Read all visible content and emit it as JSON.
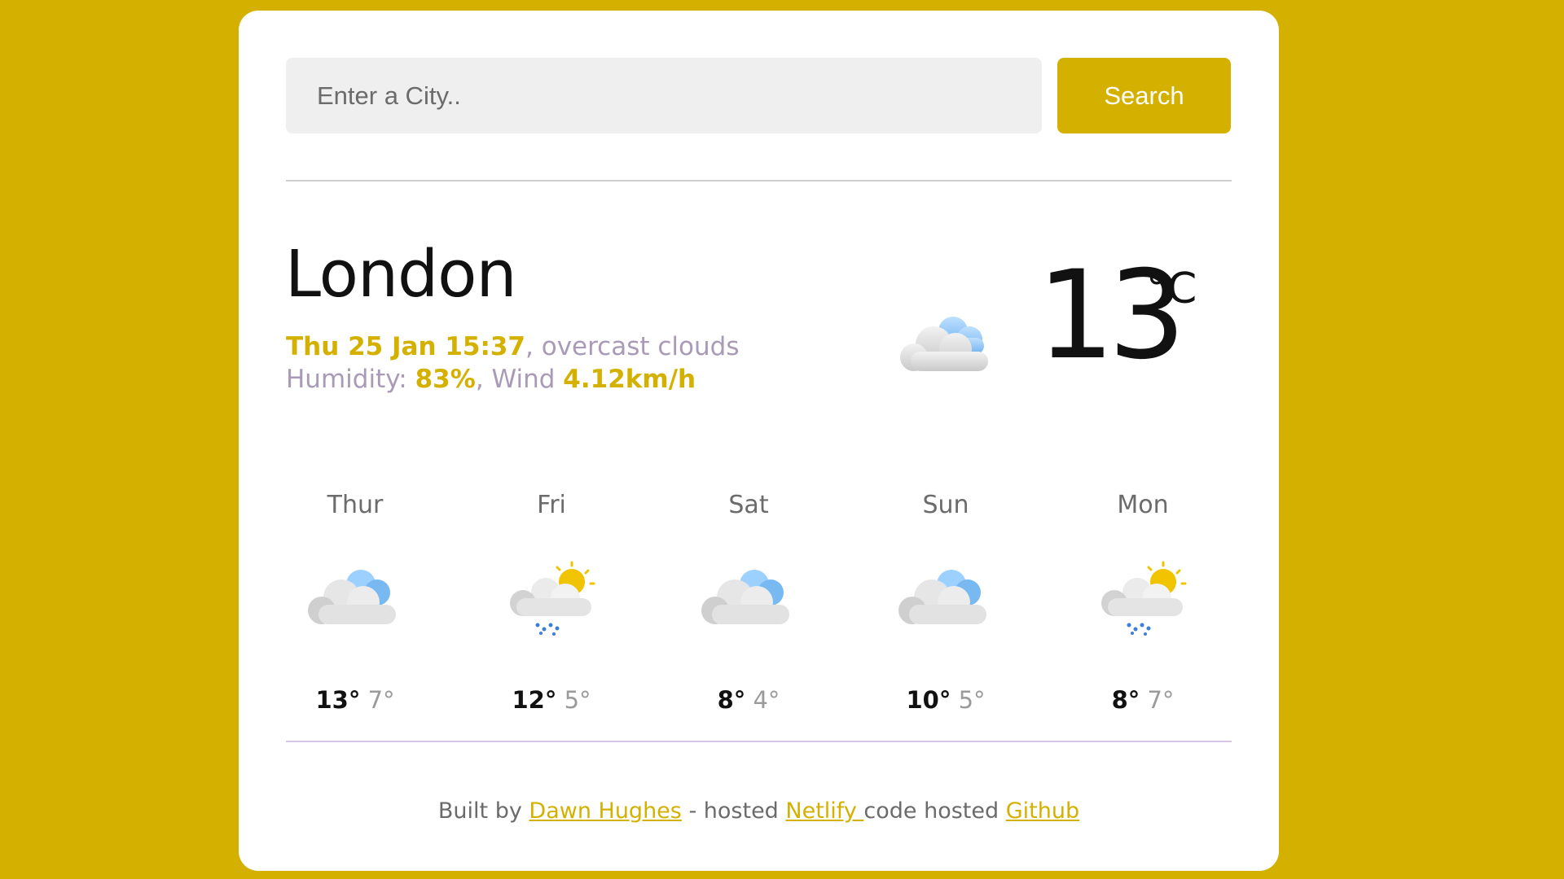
{
  "search": {
    "placeholder": "Enter a City..",
    "button_label": "Search"
  },
  "current": {
    "city": "London",
    "date_time": "Thu 25 Jan 15:37",
    "description": ", overcast clouds",
    "humidity_label": "Humidity: ",
    "humidity_value": "83%",
    "wind_label": ", Wind ",
    "wind_value": "4.12km/h",
    "temperature": "13",
    "unit": "°C",
    "icon": "overcast-clouds-icon"
  },
  "forecast": [
    {
      "day": "Thur",
      "max": "13°",
      "min": "7°",
      "icon": "overcast-clouds-icon"
    },
    {
      "day": "Fri",
      "max": "12°",
      "min": "5°",
      "icon": "sun-cloud-rain-icon"
    },
    {
      "day": "Sat",
      "max": "8°",
      "min": "4°",
      "icon": "overcast-clouds-icon"
    },
    {
      "day": "Sun",
      "max": "10°",
      "min": "5°",
      "icon": "overcast-clouds-icon"
    },
    {
      "day": "Mon",
      "max": "8°",
      "min": "7°",
      "icon": "sun-cloud-rain-icon"
    }
  ],
  "footer": {
    "built_by": "Built by ",
    "author": "Dawn Hughes",
    "hosted_text": " - hosted ",
    "host": "Netlify ",
    "code_text": "code hosted ",
    "repo": "Github"
  },
  "colors": {
    "accent": "#d4b100",
    "muted_text": "#a99bb7",
    "card": "#ffffff"
  }
}
